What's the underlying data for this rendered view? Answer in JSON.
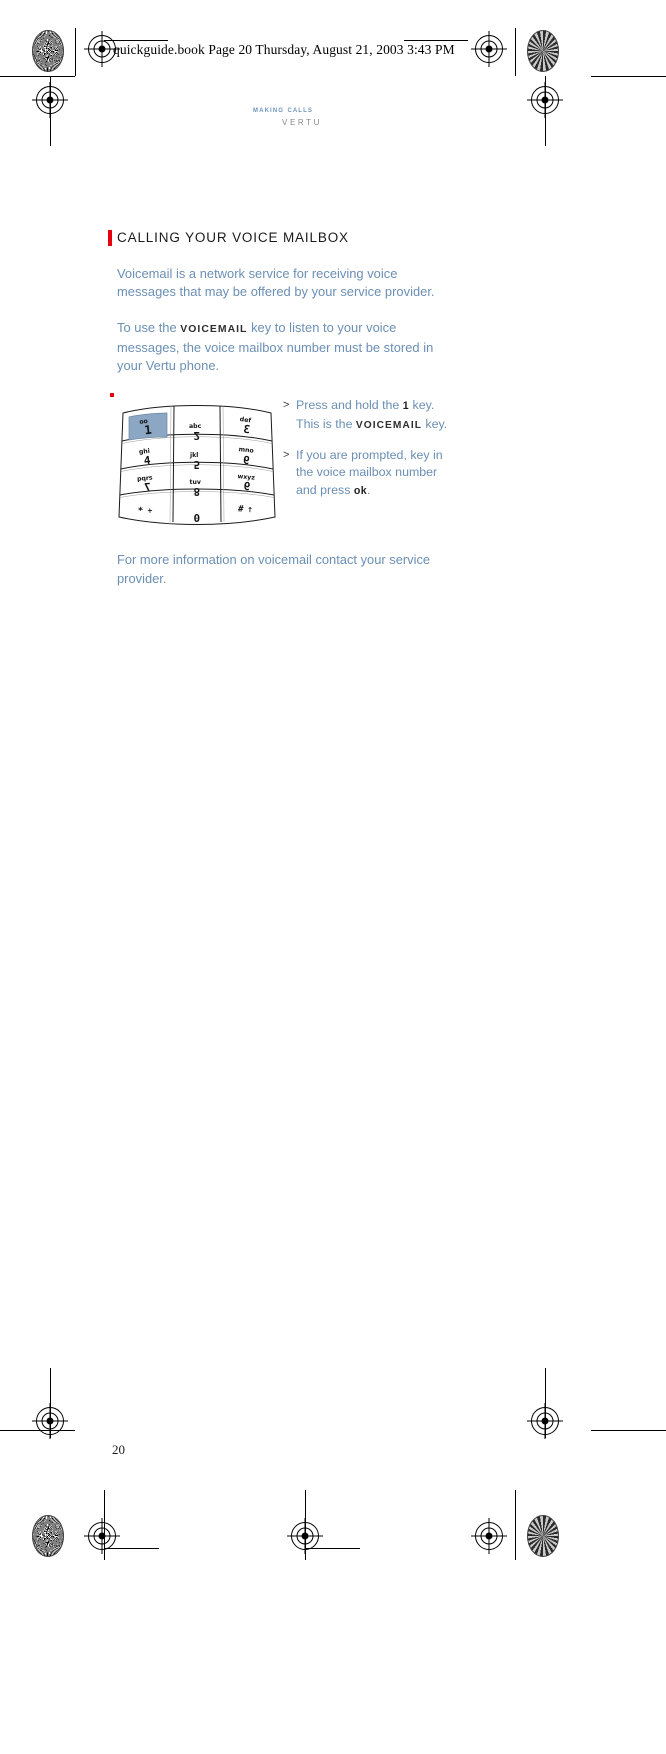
{
  "crop_header": {
    "text": "quickguide.book  Page 20  Thursday, August 21, 2003  3:43 PM"
  },
  "running_head": {
    "section": "Making calls",
    "brand": "VERTU"
  },
  "section": {
    "title": "CALLING YOUR VOICE MAILBOX",
    "paragraph_1": "Voicemail is a network service for receiving voice messages that may be offered by your service provider.",
    "paragraph_2_before": "To use the ",
    "paragraph_2_key": "voicemail",
    "paragraph_2_after": " key to listen to your voice messages, the voice mailbox number must be stored in your Vertu phone.",
    "closing": "For more information on voicemail contact your service provider."
  },
  "steps": [
    {
      "marker": ">",
      "text_1": "Press and hold the ",
      "key": "1",
      "text_2": " key. This is the ",
      "key_name": "voicemail",
      "text_3": " key."
    },
    {
      "marker": ">",
      "text_1": "If you are prompted, key in the voice mailbox number and press ",
      "key": "ok",
      "text_2": "."
    }
  ],
  "keypad": {
    "caption": "phone-keypad-illustration",
    "highlight_key": "1",
    "keys": [
      {
        "num": "1",
        "letters": "oo",
        "highlight": true
      },
      {
        "num": "2",
        "letters": "abc",
        "highlight": false
      },
      {
        "num": "3",
        "letters": "def",
        "highlight": false
      },
      {
        "num": "4",
        "letters": "ghi",
        "highlight": false
      },
      {
        "num": "5",
        "letters": "jkl",
        "highlight": false
      },
      {
        "num": "6",
        "letters": "mno",
        "highlight": false
      },
      {
        "num": "7",
        "letters": "pqrs",
        "highlight": false
      },
      {
        "num": "8",
        "letters": "tuv",
        "highlight": false
      },
      {
        "num": "9",
        "letters": "wxyz",
        "highlight": false
      },
      {
        "num": "*",
        "letters": "+",
        "highlight": false
      },
      {
        "num": "0",
        "letters": "",
        "highlight": false
      },
      {
        "num": "#",
        "letters": "↑",
        "highlight": false
      }
    ],
    "highlight_color": "#8ba7c4"
  },
  "footer": {
    "page_number": "20"
  },
  "colors": {
    "body_text": "#6b8fb5",
    "heading": "#1b1b1b",
    "red_marker": "#e8000d",
    "running_head": "#6e93bd",
    "brand": "#8a8a8a"
  }
}
